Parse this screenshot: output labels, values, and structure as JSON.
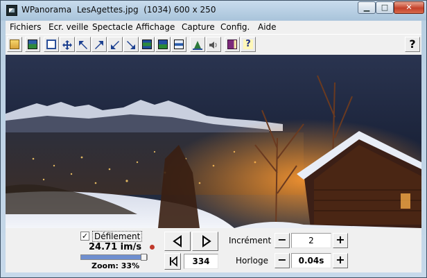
{
  "window": {
    "title": "WPanorama  LesAgettes.jpg  (1034) 600 x 250",
    "icon": "wpanorama-app-icon"
  },
  "controls": {
    "minimize": "minimize-icon",
    "maximize": "maximize-icon",
    "close": "close-icon"
  },
  "menu": [
    {
      "label": "Fichiers"
    },
    {
      "label": "Ecr. veille"
    },
    {
      "label": "Spectacle"
    },
    {
      "label": "Affichage"
    },
    {
      "label": "Capture"
    },
    {
      "label": "Config."
    },
    {
      "label": "Aide"
    }
  ],
  "toolbar": {
    "buttons": [
      "open-folder-icon",
      "landscape-image-icon",
      "window-icon",
      "move-arrows-icon",
      "arrow-up-left-icon",
      "arrow-up-right-icon",
      "arrow-down-left-icon",
      "arrow-down-right-icon",
      "panorama-strip-icon",
      "panorama-wide-icon",
      "panorama-bar-icon",
      "pyramid-icon",
      "speaker-icon",
      "book-icon",
      "help-index-icon"
    ],
    "help_label": "?"
  },
  "panel": {
    "scroll_label": "Défilement",
    "scroll_checked": "✓",
    "speed": "24.71 im/s",
    "zoom": "Zoom: 33%",
    "zoom_fraction": 0.33,
    "frame_value": "334",
    "increment_label": "Incrément",
    "increment_value": "2",
    "clock_label": "Horloge",
    "clock_value": "0.04s",
    "minus": "−",
    "plus": "+"
  },
  "colors": {
    "sky": "#1e2742",
    "snow": "#dde3ee",
    "cabin_light": "#ff9a30",
    "titlebar": "#b9cfe2"
  }
}
